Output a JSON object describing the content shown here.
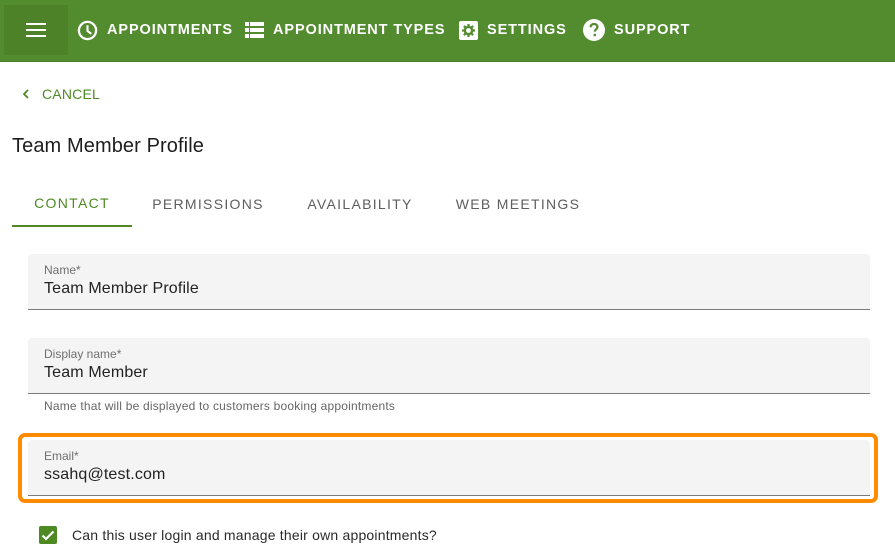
{
  "topbar": {
    "menu_icon": "hamburger-menu-icon",
    "nav": [
      {
        "label": "APPOINTMENTS",
        "icon": "clock-icon"
      },
      {
        "label": "APPOINTMENT TYPES",
        "icon": "list-icon"
      },
      {
        "label": "SETTINGS",
        "icon": "gear-icon"
      },
      {
        "label": "SUPPORT",
        "icon": "help-circle-icon"
      }
    ]
  },
  "cancel": {
    "label": "CANCEL",
    "icon": "chevron-left-icon"
  },
  "page": {
    "title": "Team Member Profile"
  },
  "tabs": [
    {
      "label": "CONTACT",
      "active": true
    },
    {
      "label": "PERMISSIONS",
      "active": false
    },
    {
      "label": "AVAILABILITY",
      "active": false
    },
    {
      "label": "WEB MEETINGS",
      "active": false
    }
  ],
  "form": {
    "name": {
      "label": "Name*",
      "value": "Team Member Profile"
    },
    "display_name": {
      "label": "Display name*",
      "value": "Team Member",
      "hint": "Name that will be displayed to customers booking appointments"
    },
    "email": {
      "label": "Email*",
      "value": "ssahq@test.com"
    },
    "login_checkbox": {
      "label": "Can this user login and manage their own appointments?",
      "checked": true
    }
  },
  "colors": {
    "brand_green": "#538b2f",
    "accent_green": "#4e8a24",
    "highlight_orange": "#ff8c00"
  }
}
